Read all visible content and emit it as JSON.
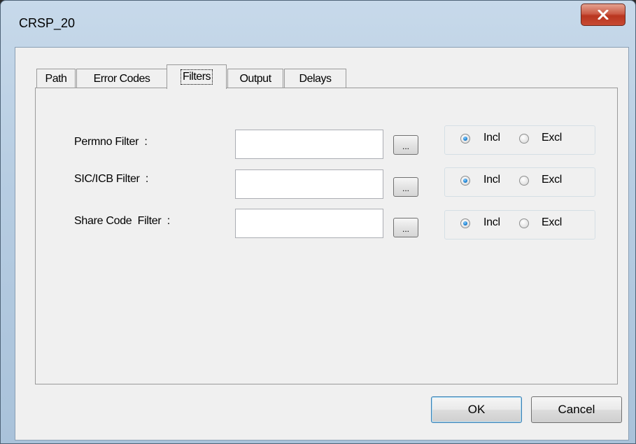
{
  "window": {
    "title": "CRSP_20",
    "close_icon": "close-icon"
  },
  "tabs": [
    {
      "label": "Path",
      "active": false
    },
    {
      "label": "Error Codes",
      "active": false
    },
    {
      "label": "Filters",
      "active": true
    },
    {
      "label": "Output",
      "active": false
    },
    {
      "label": "Delays",
      "active": false
    }
  ],
  "filters": [
    {
      "label": "Permno Filter  :",
      "value": "",
      "browse_label": "...",
      "include_label": "Incl",
      "exclude_label": "Excl",
      "selected": "Incl"
    },
    {
      "label": "SIC/ICB Filter  :",
      "value": "",
      "browse_label": "...",
      "include_label": "Incl",
      "exclude_label": "Excl",
      "selected": "Incl"
    },
    {
      "label": "Share Code  Filter  :",
      "value": "",
      "browse_label": "...",
      "include_label": "Incl",
      "exclude_label": "Excl",
      "selected": "Incl"
    }
  ],
  "buttons": {
    "ok_label": "OK",
    "cancel_label": "Cancel"
  },
  "colors": {
    "close_button": "#c7472f",
    "radio_checked": "#1a7fd0"
  }
}
